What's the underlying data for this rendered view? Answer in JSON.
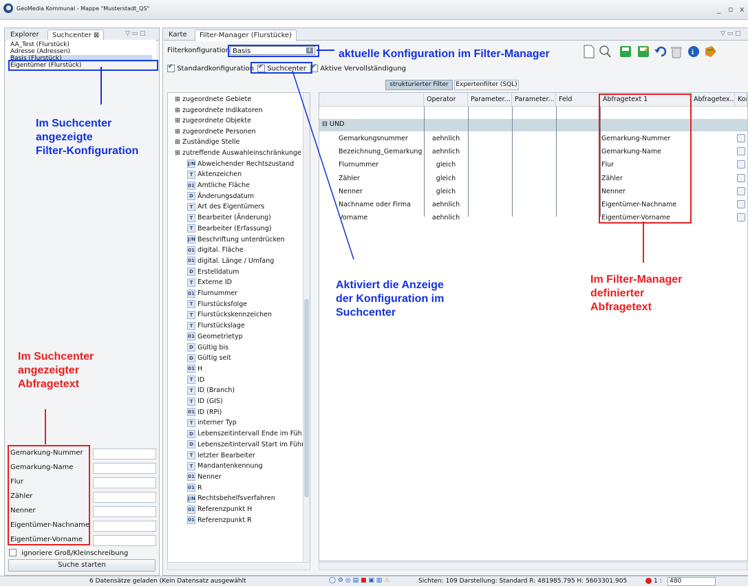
{
  "window": {
    "title": "GeoMedia Kommunal - Mappe \"Musterstadt_QS\"",
    "min": "_",
    "max": "▫",
    "close": "x"
  },
  "left_tabs": [
    "Explorer",
    "Suchcenter ⊠"
  ],
  "configs": [
    "AA_Test (Flurstück)",
    "Adresse (Adressen)",
    "Basis (Flurstück)",
    "Eigentümer (Flurstück)"
  ],
  "search_fields": [
    "Gemarkung-Nummer",
    "Gemarkung-Name",
    "Flur",
    "Zähler",
    "Nenner",
    "Eigentümer-Nachname",
    "Eigentümer-Vorname"
  ],
  "ignore_case": "ignoriere Groß/Kleinschreibung",
  "search_button": "Suche starten",
  "center_tabs": [
    "Karte",
    "Filter-Manager (Flurstücke)"
  ],
  "filter_config_label": "Filterkonfiguration",
  "filter_config_value": "Basis",
  "checks": {
    "standard": "Standardkonfiguration",
    "suchcenter": "Suchcenter",
    "auto": "Aktive Vervollständigung"
  },
  "filter_tabs": [
    "strukturierter Filter",
    "Expertenfilter (SQL)"
  ],
  "tree_groups": [
    "zugeordnete Gebiete",
    "zugeordnete Indikatoren",
    "zugeordnete Objekte",
    "zugeordnete Personen",
    "Zuständige Stelle",
    "zutreffende Auswahleinschränkunge"
  ],
  "tree_items": [
    {
      "i": "J/N",
      "t": "Abweichender Rechtszustand"
    },
    {
      "i": "T",
      "t": "Aktenzeichen"
    },
    {
      "i": "01",
      "t": "Amtliche Fläche"
    },
    {
      "i": "D",
      "t": "Änderungsdatum"
    },
    {
      "i": "T",
      "t": "Art des Eigentümers"
    },
    {
      "i": "T",
      "t": "Bearbeiter (Änderung)"
    },
    {
      "i": "T",
      "t": "Bearbeiter (Erfassung)"
    },
    {
      "i": "J/N",
      "t": "Beschriftung unterdrücken"
    },
    {
      "i": "01",
      "t": "digital. Fläche"
    },
    {
      "i": "01",
      "t": "digital. Länge / Umfang"
    },
    {
      "i": "D",
      "t": "Erstelldatum"
    },
    {
      "i": "T",
      "t": "Externe ID"
    },
    {
      "i": "01",
      "t": "Flurnummer"
    },
    {
      "i": "T",
      "t": "Flurstücksfolge"
    },
    {
      "i": "T",
      "t": "Flurstückskennzeichen"
    },
    {
      "i": "T",
      "t": "Flurstückslage"
    },
    {
      "i": "01",
      "t": "Geometrietyp"
    },
    {
      "i": "D",
      "t": "Gültig bis"
    },
    {
      "i": "D",
      "t": "Gültig seit"
    },
    {
      "i": "01",
      "t": "H"
    },
    {
      "i": "T",
      "t": "ID"
    },
    {
      "i": "T",
      "t": "ID (Branch)"
    },
    {
      "i": "T",
      "t": "ID (GIS)"
    },
    {
      "i": "01",
      "t": "ID (RPi)"
    },
    {
      "i": "T",
      "t": "interner Typ"
    },
    {
      "i": "D",
      "t": "Lebenszeitintervall Ende im Füh"
    },
    {
      "i": "D",
      "t": "Lebenszeitintervall Start im Führ"
    },
    {
      "i": "T",
      "t": "letzter Bearbeiter"
    },
    {
      "i": "T",
      "t": "Mandantenkennung"
    },
    {
      "i": "01",
      "t": "Nenner"
    },
    {
      "i": "01",
      "t": "R"
    },
    {
      "i": "J/N",
      "t": "Rechtsbehelfsverfahren"
    },
    {
      "i": "01",
      "t": "Referenzpunkt H"
    },
    {
      "i": "01",
      "t": "Referenzpunkt R"
    }
  ],
  "grid_headers": [
    "Operator",
    "Parameter...",
    "Parameter...",
    "Feld",
    "Abfragetext 1",
    "Abfragetex...",
    "Kor"
  ],
  "grid_group": "UND",
  "grid_rows": [
    {
      "name": "Gemarkungsnummer",
      "op": "aehnlich",
      "q": "Gemarkung-Nummer"
    },
    {
      "name": "Bezeichnung_Gemarkung",
      "op": "aehnlich",
      "q": "Gemarkung-Name"
    },
    {
      "name": "Flurnummer",
      "op": "gleich",
      "q": "Flur"
    },
    {
      "name": "Zähler",
      "op": "gleich",
      "q": "Zähler"
    },
    {
      "name": "Nenner",
      "op": "gleich",
      "q": "Nenner"
    },
    {
      "name": "Nachname oder Firma",
      "op": "aehnlich",
      "q": "Eigentümer-Nachname"
    },
    {
      "name": "Vorname",
      "op": "aehnlich",
      "q": "Eigentümer-Vorname"
    }
  ],
  "annotations": {
    "current_config": "aktuelle Konfiguration im Filter-Manager",
    "suchcenter_config": [
      "Im Suchcenter",
      "angezeigte",
      "Filter-Konfiguration"
    ],
    "activates": [
      "Aktiviert die Anzeige",
      "der Konfiguration im",
      "Suchcenter"
    ],
    "fm_text": [
      "Im Filter-Manager",
      "definierter",
      "Abfragetext"
    ],
    "sc_text": [
      "Im Suchcenter",
      "angezeigter",
      "Abfragetext"
    ]
  },
  "status": {
    "left": "6 Datensätze geladen (Kein Datensatz ausgewählt",
    "right": "Sichten: 109  Darstellung: Standard  R: 481985.795  H: 5603301.905",
    "scale_label": "1 :",
    "scale_value": "480"
  },
  "colors": {
    "annotation_blue": "#1432dc",
    "annotation_red": "#e81e1e",
    "group_row": "#cbd9e1"
  }
}
